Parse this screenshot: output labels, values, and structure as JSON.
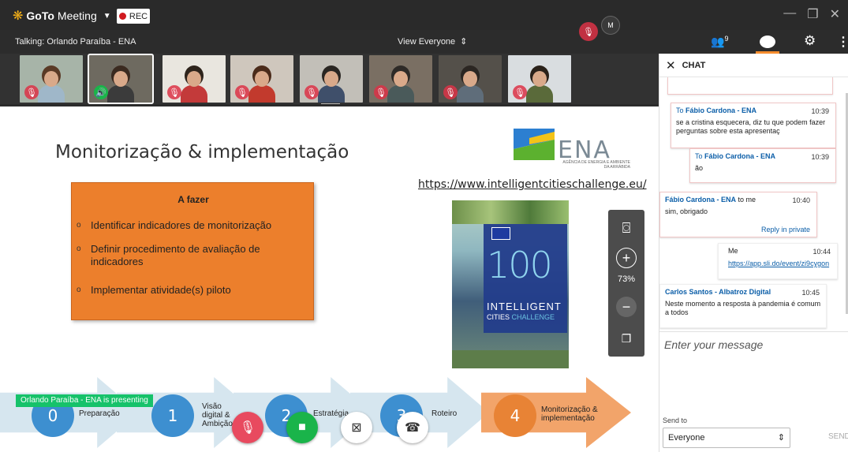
{
  "app": {
    "name_bold": "GoTo",
    "name_rest": "Meeting",
    "rec_label": "REC"
  },
  "header": {
    "talking": "Talking: Orlando Paraíba - ENA",
    "view_selector": "View Everyone",
    "attendee_count": "9"
  },
  "thumbnails": [
    {
      "speaking": false,
      "muted": true,
      "bg": "#a7b4a8",
      "hair": "#5a3a26",
      "shirt": "#9fb7c9"
    },
    {
      "speaking": true,
      "muted": false,
      "bg": "#6e6a60",
      "hair": "#3b2a20",
      "shirt": "#3b3b3b"
    },
    {
      "speaking": false,
      "muted": true,
      "bg": "#e9e6df",
      "hair": "#2e241c",
      "shirt": "#c33a3a"
    },
    {
      "speaking": false,
      "muted": true,
      "bg": "#cfc7bd",
      "hair": "#4b2b1a",
      "shirt": "#c23a2d"
    },
    {
      "speaking": false,
      "muted": true,
      "bg": "#c2bfb8",
      "hair": "#2a2622",
      "shirt": "#3f4f6a"
    },
    {
      "speaking": false,
      "muted": true,
      "bg": "#7a6f63",
      "hair": "#2e2a27",
      "shirt": "#4a5a5a"
    },
    {
      "speaking": false,
      "muted": true,
      "bg": "#54504a",
      "hair": "#2b2622",
      "shirt": "#5f6d7a"
    },
    {
      "speaking": false,
      "muted": true,
      "bg": "#d9dde0",
      "hair": "#2a211a",
      "shirt": "#5a6a3a"
    }
  ],
  "avatar_initial": "M",
  "slide": {
    "title": "Monitorização & implementação",
    "logo_text": "ENA",
    "logo_subtitle": "AGÊNCIA DE ENERGIA E AMBIENTE DA ARRÁBIDA",
    "link": "https://www.intelligentcitieschallenge.eu/",
    "todo_title": "A fazer",
    "todo_items": [
      "Identificar indicadores de monitorização",
      "Definir procedimento de avaliação de indicadores",
      "Implementar atividade(s) piloto"
    ],
    "book_number": "100",
    "book_line1": "INTELLIGENT",
    "book_line2a": "CITIES",
    "book_line2b": "CHALLENGE",
    "stages": [
      {
        "num": "0",
        "label": "Preparação"
      },
      {
        "num": "1",
        "label": "Visão digital & Ambição"
      },
      {
        "num": "2",
        "label": "Estratégia"
      },
      {
        "num": "3",
        "label": "Roteiro"
      },
      {
        "num": "4",
        "label": "Monitorização & implementação"
      }
    ]
  },
  "zoom": {
    "percent": "73%"
  },
  "presenting_banner": "Orlando Paraíba - ENA is presenting",
  "controls": {
    "mic": "Mic",
    "camera": "Camera",
    "screen": "Screen",
    "leave": "Leave"
  },
  "chat": {
    "title": "CHAT",
    "messages": [
      {
        "prefix": "To ",
        "who": "Fábio Cardona - ENA",
        "suffix": "",
        "time": "10:39",
        "text": "se a cristina esquecera, diz tu que podem fazer perguntas sobre esta apresentaç"
      },
      {
        "prefix": "To ",
        "who": "Fábio Cardona - ENA",
        "suffix": "",
        "time": "10:39",
        "text": "ão"
      },
      {
        "prefix": "",
        "who": "Fábio Cardona - ENA",
        "suffix": " to me",
        "time": "10:40",
        "text": "sim, obrigado",
        "reply": "Reply in private"
      },
      {
        "prefix": "",
        "who": "Me",
        "suffix": "",
        "time": "10:44",
        "text": "https://app.sli.do/event/zi9cygon"
      },
      {
        "prefix": "",
        "who": "Carlos Santos - Albatroz Digital",
        "suffix": "",
        "time": "10:45",
        "text": "Neste momento a resposta à pandemia é comum a todos"
      }
    ],
    "input_placeholder": "Enter your message",
    "send_to_label": "Send to",
    "send_to_value": "Everyone",
    "send_label": "SEND"
  }
}
